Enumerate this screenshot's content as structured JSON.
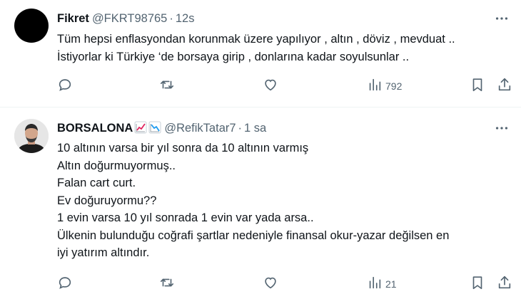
{
  "tweets": [
    {
      "name": "Fikret",
      "handle": "@FKRT98765",
      "separator": "·",
      "time": "12s",
      "lines": [
        "Tüm hepsi enflasyondan korunmak üzere yapılıyor , altın , döviz , mevduat ..",
        "İstiyorlar ki Türkiye ‘de borsaya girip , donlarına kadar soyulsunlar .."
      ],
      "views": "792"
    },
    {
      "name": "BORSALONA",
      "handle": "@RefikTatar7",
      "separator": "·",
      "time": "1 sa",
      "lines": [
        "10 altının varsa bir yıl sonra da 10 altının varmış",
        "Altın doğurmuyormuş..",
        "Falan cart curt.",
        "Ev doğuruyormu??",
        "1 evin varsa 10 yıl sonrada 1 evin var yada arsa..",
        "Ülkenin bulunduğu coğrafi şartlar nedeniyle finansal okur-yazar değilsen en",
        "iyi yatırım altındır."
      ],
      "views": "21"
    }
  ],
  "icons": {
    "more": "more-horizontal-icon",
    "reply": "reply-icon",
    "retweet": "retweet-icon",
    "like": "heart-icon",
    "views": "views-chart-icon",
    "bookmark": "bookmark-icon",
    "share": "share-icon",
    "badges": [
      "chart-increasing-emoji",
      "chart-decreasing-emoji"
    ]
  },
  "colors": {
    "text": "#0f1419",
    "secondary": "#536471",
    "divider": "#eff3f4"
  }
}
